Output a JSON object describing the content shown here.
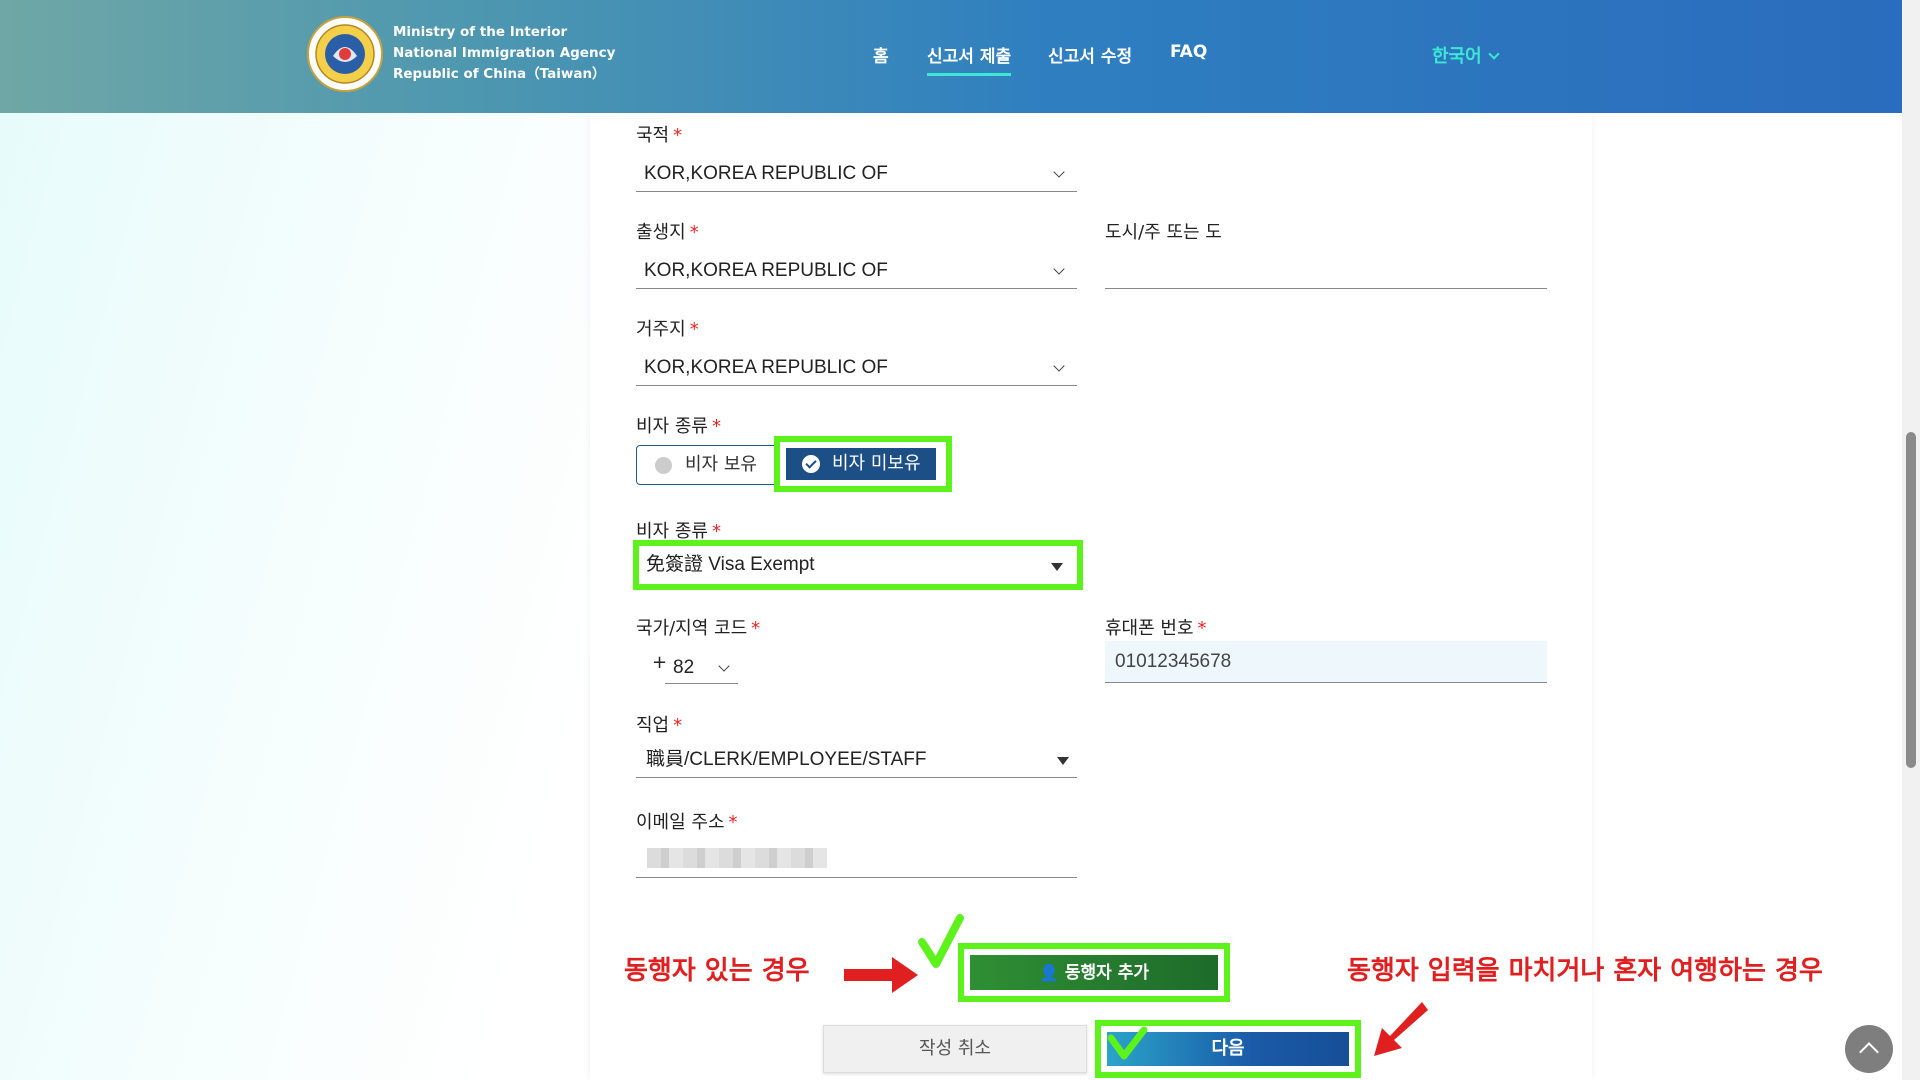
{
  "header": {
    "agency_lines": [
      "Ministry of the Interior",
      "National Immigration Agency",
      "Republic of China（Taiwan）"
    ],
    "nav": [
      "홈",
      "신고서 제출",
      "신고서 수정",
      "FAQ"
    ],
    "language": "한국어"
  },
  "form": {
    "nationality": {
      "label": "국적",
      "value": "KOR,KOREA REPUBLIC OF"
    },
    "birthplace": {
      "label": "출생지",
      "value": "KOR,KOREA REPUBLIC OF"
    },
    "city": {
      "label": "도시/주 또는 도",
      "value": ""
    },
    "residence": {
      "label": "거주지",
      "value": "KOR,KOREA REPUBLIC OF"
    },
    "visa_type": {
      "label": "비자 종류",
      "options": [
        "비자 보유",
        "비자 미보유"
      ],
      "selected": "비자 미보유"
    },
    "visa_type2": {
      "label": "비자 종류",
      "value": "免簽證 Visa Exempt"
    },
    "country_code": {
      "label": "국가/지역 코드",
      "plus": "+",
      "value": "82"
    },
    "mobile": {
      "label": "휴대폰 번호",
      "value": "01012345678"
    },
    "occupation": {
      "label": "직업",
      "value": "職員/CLERK/EMPLOYEE/STAFF"
    },
    "email": {
      "label": "이메일 주소"
    },
    "required_mark": "*"
  },
  "buttons": {
    "add_companion": "동행자 추가",
    "cancel": "작성 취소",
    "next": "다음"
  },
  "annotations": {
    "with_companion": "동행자 있는 경우",
    "alone": "동행자 입력을 마치거나 혼자 여행하는 경우"
  },
  "colors": {
    "highlight": "#5ef21c",
    "annotation": "#e02020",
    "primary": "#1c4f86",
    "accent": "#3ee6d4"
  }
}
